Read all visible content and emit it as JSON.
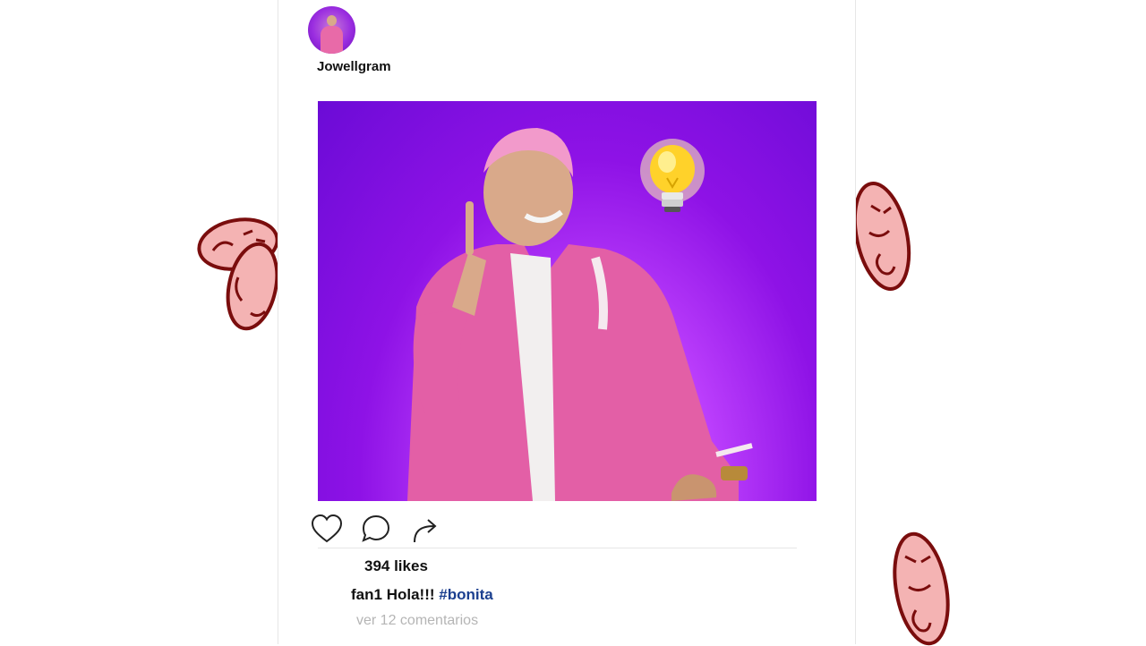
{
  "post": {
    "username": "Jowellgram",
    "likes_text": "394 likes",
    "caption": {
      "user": "fan1",
      "text": "Hola!!!",
      "hashtag": "#bonita"
    },
    "comments_link": "ver 12 comentarios"
  },
  "actions": [
    {
      "name": "like",
      "icon": "heart-icon"
    },
    {
      "name": "comment",
      "icon": "comment-icon"
    },
    {
      "name": "share",
      "icon": "share-arrow-icon"
    }
  ],
  "colors": {
    "media_background": "#8e12e6",
    "hashtag": "#1b3f8f",
    "muted_text": "#b5b5b5",
    "sticker_face": "#f4b3b3",
    "sticker_outline": "#7a0d0d"
  },
  "decorations": {
    "sticker_icon": "angry-face-sticker-icon",
    "media_icon": "lightbulb-icon"
  }
}
